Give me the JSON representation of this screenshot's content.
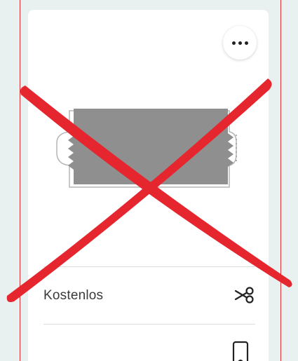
{
  "card": {
    "more_button": {
      "icon": "more-horizontal-icon"
    },
    "image": {
      "icon": "coupon-ticket-icon"
    },
    "offer_row": {
      "label": "Kostenlos",
      "icon": "scissors-icon"
    },
    "next_row": {
      "icon": "mobile-phone-icon"
    }
  },
  "overlay": {
    "icon": "red-cross-icon",
    "color": "#e5262e"
  },
  "colors": {
    "background": "#e8f1ef",
    "card": "#ffffff",
    "frame_line": "#d92f36",
    "coupon_fill": "#8f8f8f"
  }
}
